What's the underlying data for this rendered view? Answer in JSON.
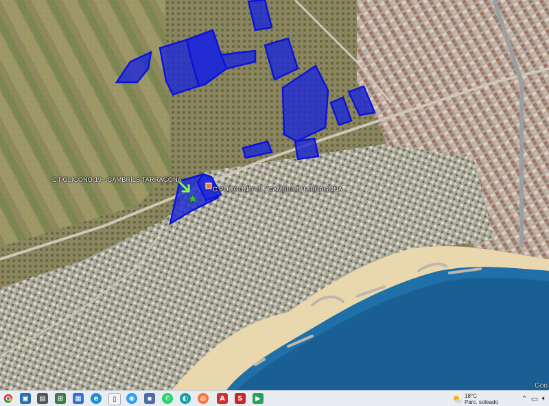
{
  "map": {
    "labels": {
      "left": "C.POLIGONO 19  - CAMBRILS TARRAGONA",
      "right": "C.POLIGONO 19  - CAMBRILS TARRAGONA"
    },
    "attribution": "Goo",
    "parcel_fill": "#1e2ad6",
    "sea_color": "#1f6fa8",
    "beach_color": "#e9d7ad"
  },
  "taskbar": {
    "apps": [
      {
        "name": "chrome-icon",
        "color": "#d93025"
      },
      {
        "name": "app-icon-2",
        "color": "#2b6cb0"
      },
      {
        "name": "app-icon-3",
        "color": "#555555"
      },
      {
        "name": "app-icon-4",
        "color": "#3a7d44"
      },
      {
        "name": "app-icon-5",
        "color": "#2f6fd6"
      },
      {
        "name": "edge-icon",
        "color": "#1a8fd6"
      },
      {
        "name": "file-icon",
        "color": "#f5f5f5"
      },
      {
        "name": "app-icon-8",
        "color": "#2a9df4"
      },
      {
        "name": "save-icon",
        "color": "#4a6fa5"
      },
      {
        "name": "whatsapp-icon",
        "color": "#25d366"
      },
      {
        "name": "app-icon-11",
        "color": "#0aa3a3"
      },
      {
        "name": "firefox-icon",
        "color": "#ff7139"
      },
      {
        "name": "acrobat-icon",
        "color": "#d32f2f"
      },
      {
        "name": "app-icon-14",
        "color": "#c62828"
      },
      {
        "name": "app-icon-15",
        "color": "#2e9e5b"
      }
    ],
    "weather": {
      "temp": "18°C",
      "condition": "Parc. soleado"
    }
  }
}
